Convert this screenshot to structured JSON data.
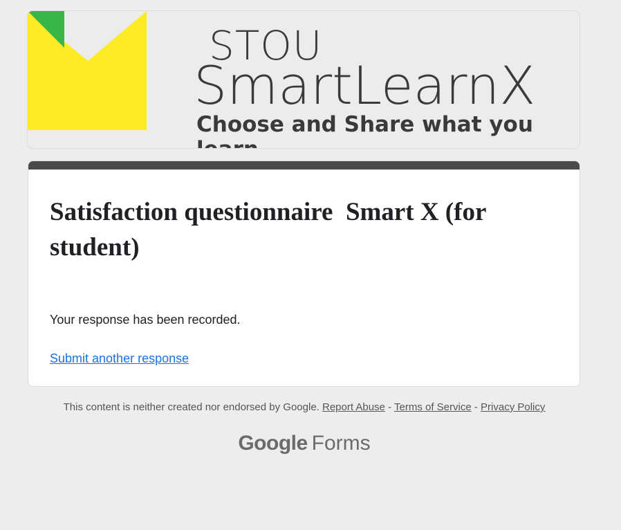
{
  "banner": {
    "brand_line1": "STOU",
    "brand_line2": "SmartLearnX",
    "tagline": "Choose and Share what you learn",
    "colors": {
      "yellow": "#fdec25",
      "green": "#3ab54a",
      "text": "#3a3a3a"
    }
  },
  "form": {
    "accent_color": "#4a4a4a",
    "title": "Satisfaction questionnaire  Smart X (for student)",
    "confirmation": "Your response has been recorded.",
    "submit_another": "Submit another response"
  },
  "footer": {
    "disclaimer": "This content is neither created nor endorsed by Google.",
    "report_abuse": "Report Abuse",
    "separator": "-",
    "terms": "Terms of Service",
    "privacy": "Privacy Policy"
  },
  "branding": {
    "google": "Google",
    "forms": "Forms"
  }
}
